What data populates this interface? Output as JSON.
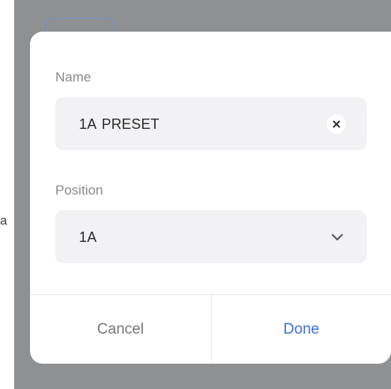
{
  "background": {
    "edge_text": "a"
  },
  "dialog": {
    "name_field": {
      "label": "Name",
      "value": "1A  PRESET",
      "clear_icon": "close-x-icon"
    },
    "position_field": {
      "label": "Position",
      "value": "1A",
      "dropdown_icon": "chevron-down-icon"
    },
    "footer": {
      "cancel_label": "Cancel",
      "done_label": "Done"
    }
  },
  "colors": {
    "accent": "#3a6fd8",
    "backdrop": "#8f9092",
    "input_bg": "#f2f2f4",
    "label_gray": "#8a8a8a"
  }
}
